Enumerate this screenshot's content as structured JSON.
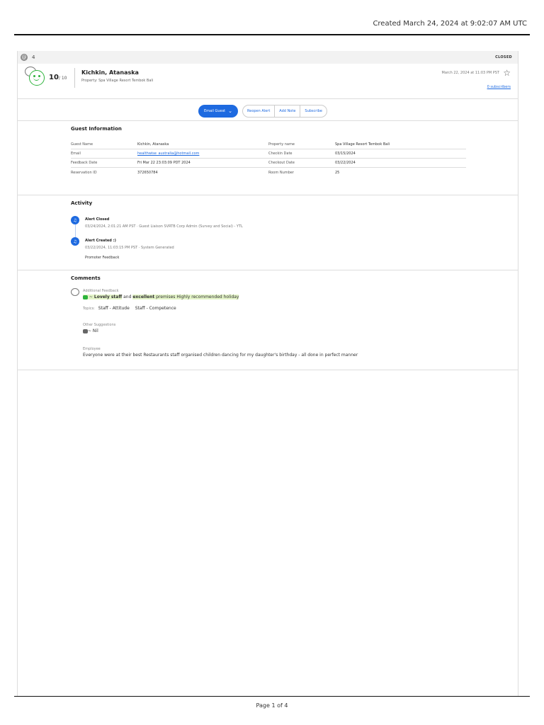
{
  "created": "Created March 24, 2024 at 9:02:07 AM UTC",
  "alert": {
    "id": "4",
    "status": "CLOSED",
    "score": "10",
    "score_max": "/ 10",
    "guest_name": "Kichkin, Atanaska",
    "property_line": "Property: Spa Village Resort Tembok Bali",
    "date": "March 22, 2024 at 11:03 PM PST",
    "subscribers": "0 subscribers"
  },
  "actions": {
    "email_guest": "Email Guest",
    "reopen": "Reopen Alert",
    "add_note": "Add Note",
    "subscribe": "Subscribe"
  },
  "guest_info": {
    "title": "Guest Information",
    "rows": [
      {
        "l1": "Guest Name",
        "v1": "Kichkin, Atanaska",
        "l2": "Property name",
        "v2": "Spa Village Resort Tembok Bali"
      },
      {
        "l1": "Email",
        "v1": "healthwise_australia@hotmail.com",
        "l2": "Checkin Date",
        "v2": "03/15/2024"
      },
      {
        "l1": "Feedback Date",
        "v1": "Fri Mar 22 23:03:09 PDT 2024",
        "l2": "Checkout Date",
        "v2": "03/22/2024"
      },
      {
        "l1": "Reservation ID",
        "v1": "372650784",
        "l2": "Room Number",
        "v2": "25"
      }
    ]
  },
  "activity": {
    "title": "Activity",
    "items": [
      {
        "title": "Alert Closed",
        "sub": "03/24/2024, 2:01:21 AM PST · Guest Liaison SVRTB Corp Admin (Survey and Social) - YTL"
      },
      {
        "title": "Alert Created :)",
        "sub": "03/22/2024, 11:03:15 PM PST · System Generated",
        "note": "Promoter Feedback"
      }
    ]
  },
  "comments": {
    "title": "Comments",
    "additional_label": "Additional Feedback",
    "additional_prefix": "~",
    "additional_bold1": "Lovely staff",
    "additional_and": " and ",
    "additional_bold2": "excellent",
    "additional_rest": " premises Highly recommended holiday",
    "topics_label": "Topics:",
    "topics": [
      "Staff - Attitude",
      "Staff - Competence"
    ],
    "suggestions_label": "Other Suggestions",
    "suggestions_text": "~ Nil",
    "employee_label": "Employee",
    "employee_text": "Everyone were at their best Restaurants staff organised children dancing for my daughter's birthday - all done in perfect manner"
  },
  "page_num": "Page 1 of 4"
}
